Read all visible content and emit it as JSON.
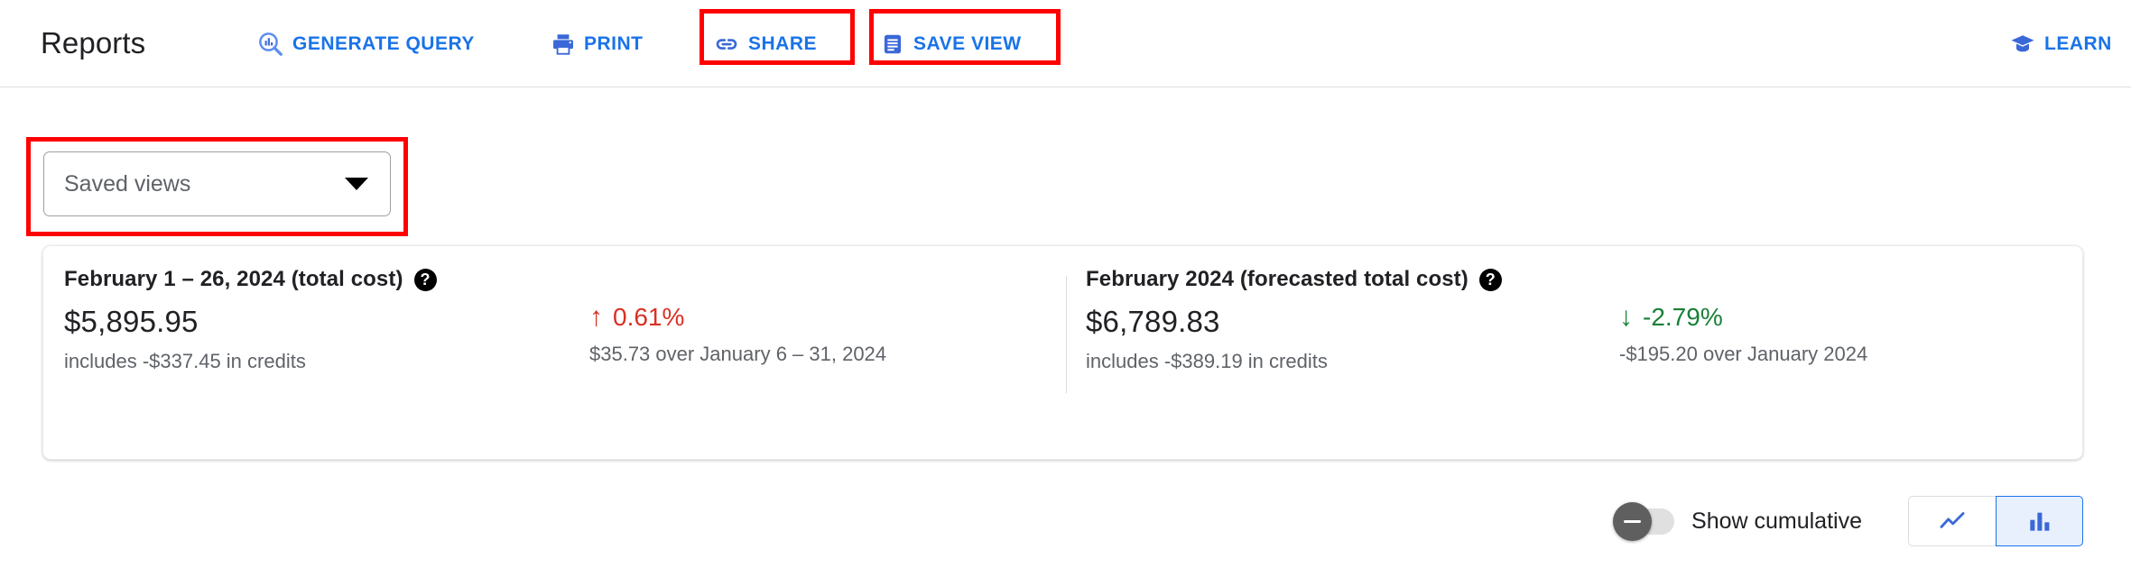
{
  "header": {
    "title": "Reports",
    "buttons": [
      {
        "id": "generate-query",
        "label": "GENERATE QUERY",
        "icon": "search-chart-icon"
      },
      {
        "id": "print",
        "label": "PRINT",
        "icon": "printer-icon"
      },
      {
        "id": "share",
        "label": "SHARE",
        "icon": "link-icon"
      },
      {
        "id": "save-view",
        "label": "SAVE VIEW",
        "icon": "document-save-icon"
      }
    ],
    "learn": {
      "label": "LEARN",
      "icon": "graduation-cap-icon"
    }
  },
  "saved_views": {
    "placeholder": "Saved views",
    "arrow_icon": "chevron-down-icon"
  },
  "summary": {
    "actual": {
      "title": "February 1 – 26, 2024 (total cost)",
      "help_icon": "help-circle-icon",
      "amount": "$5,895.95",
      "credits": "includes -$337.45 in credits",
      "delta_arrow": "↑",
      "delta_pct": "0.61%",
      "delta_direction": "up",
      "delta_detail": "$35.73 over January 6 – 31, 2024"
    },
    "forecast": {
      "title": "February 2024 (forecasted total cost)",
      "help_icon": "help-circle-icon",
      "amount": "$6,789.83",
      "credits": "includes -$389.19 in credits",
      "delta_arrow": "↓",
      "delta_pct": "-2.79%",
      "delta_direction": "down",
      "delta_detail": "-$195.20 over January 2024"
    }
  },
  "controls": {
    "cumulative_toggle": {
      "label": "Show cumulative",
      "state": "off",
      "icon": "minus-toggle-icon"
    },
    "chart_type": {
      "line": {
        "icon": "line-chart-icon",
        "selected": false
      },
      "bar": {
        "icon": "bar-chart-icon",
        "selected": true
      }
    }
  },
  "annotations": {
    "highlight_color": "#ff0000",
    "highlighted": [
      "share",
      "save-view",
      "saved-views-select"
    ]
  },
  "colors": {
    "accent_blue": "#1a73e8",
    "negative_red": "#d93025",
    "positive_green": "#188038",
    "text_primary": "#202124",
    "text_secondary": "#5f6368"
  }
}
